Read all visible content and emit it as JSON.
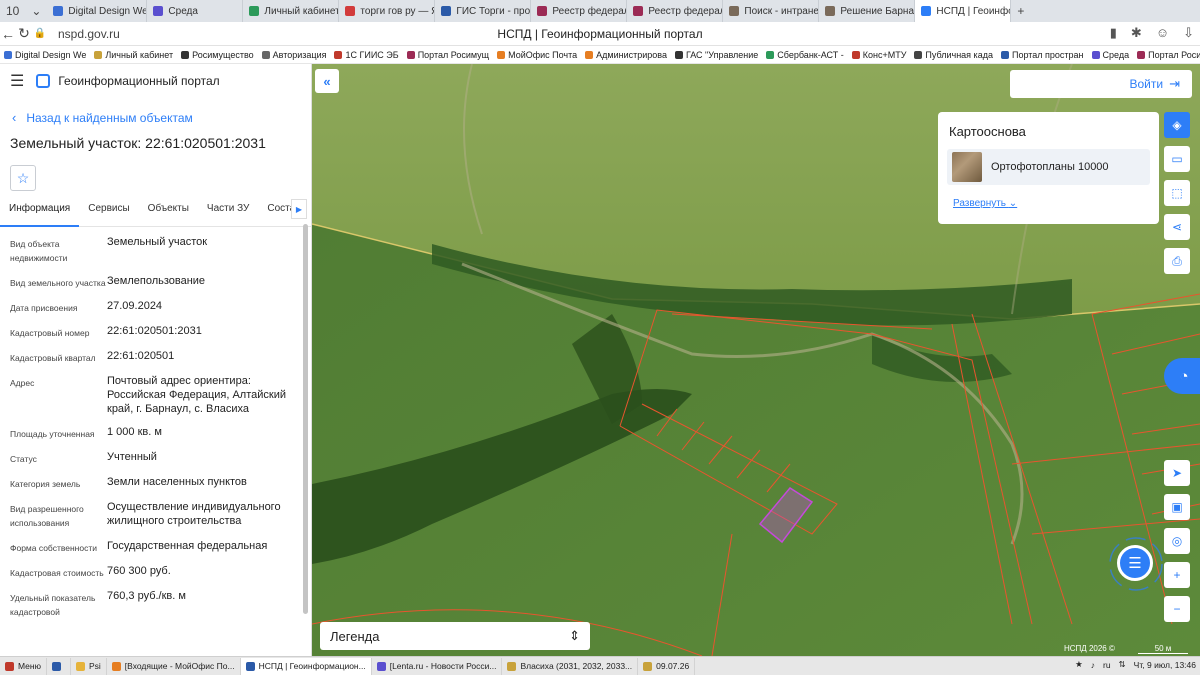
{
  "browser": {
    "tab_count": "10",
    "tabs": [
      {
        "label": "Digital Design We",
        "color": "#3b6fd4"
      },
      {
        "label": "Среда",
        "color": "#5a4fcf"
      },
      {
        "label": "Личный кабинет",
        "color": "#2c9a5a"
      },
      {
        "label": "торги гов ру — Я",
        "color": "#d23b3b"
      },
      {
        "label": "ГИС Торги - прод",
        "color": "#2b5aa8"
      },
      {
        "label": "Реестр федераль",
        "color": "#9c2b55"
      },
      {
        "label": "Реестр федераль",
        "color": "#9c2b55"
      },
      {
        "label": "Поиск - интранет",
        "color": "#7a6a5a"
      },
      {
        "label": "Решение Барнаул",
        "color": "#7a6a5a"
      },
      {
        "label": "НСПД | Геоинфо",
        "color": "#2d7ef7"
      }
    ],
    "new_tab": "+",
    "url": "nspd.gov.ru",
    "page_title": "НСПД | Геоинформационный портал"
  },
  "bookmarks": [
    {
      "label": "Digital Design We",
      "color": "#3b6fd4"
    },
    {
      "label": "Личный кабинет",
      "color": "#c8a23a"
    },
    {
      "label": "Росимущество",
      "color": "#333333"
    },
    {
      "label": "Авторизация",
      "color": "#666666"
    },
    {
      "label": "1С ГИИС ЭБ",
      "color": "#c0392b"
    },
    {
      "label": "Портал Росимущ",
      "color": "#9c2b55"
    },
    {
      "label": "МойОфис Почта",
      "color": "#e67e22"
    },
    {
      "label": "Администрирова",
      "color": "#e67e22"
    },
    {
      "label": "ГАС \"Управление",
      "color": "#333333"
    },
    {
      "label": "Сбербанк-АСТ -",
      "color": "#2c9a5a"
    },
    {
      "label": "Конс+МТУ",
      "color": "#c0392b"
    },
    {
      "label": "Публичная када",
      "color": "#444444"
    },
    {
      "label": "Портал простран",
      "color": "#2b5aa8"
    },
    {
      "label": "Среда",
      "color": "#5a4fcf"
    },
    {
      "label": "Портал Роси",
      "color": "#9c2b55"
    }
  ],
  "app": {
    "title": "Геоинформационный портал",
    "back_label": "Назад к найденным объектам",
    "object_title": "Земельный участок: 22:61:020501:2031",
    "tabs": [
      "Информация",
      "Сервисы",
      "Объекты",
      "Части ЗУ",
      "Состав"
    ],
    "properties": [
      {
        "key": "Вид объекта недвижимости",
        "value": "Земельный участок"
      },
      {
        "key": "Вид земельного участка",
        "value": "Землепользование"
      },
      {
        "key": "Дата присвоения",
        "value": "27.09.2024"
      },
      {
        "key": "Кадастровый номер",
        "value": "22:61:020501:2031"
      },
      {
        "key": "Кадастровый квартал",
        "value": "22:61:020501"
      },
      {
        "key": "Адрес",
        "value": "Почтовый адрес ориентира: Российская Федерация, Алтайский край, г. Барнаул, с. Власиха"
      },
      {
        "key": "Площадь уточненная",
        "value": "1 000 кв. м"
      },
      {
        "key": "Статус",
        "value": "Учтенный"
      },
      {
        "key": "Категория земель",
        "value": "Земли населенных пунктов"
      },
      {
        "key": "Вид разрешенного использования",
        "value": "Осуществление индивидуального жилищного строительства"
      },
      {
        "key": "Форма собственности",
        "value": "Государственная федеральная"
      },
      {
        "key": "Кадастровая стоимость",
        "value": "760 300 руб."
      },
      {
        "key": "Удельный показатель кадастровой",
        "value": "760,3 руб./кв. м"
      }
    ]
  },
  "map": {
    "login_label": "Войти",
    "basemap_title": "Картооснова",
    "basemap_layer": "Ортофотопланы 10000",
    "expand_label": "Развернуть",
    "legend_label": "Легенда",
    "copyright": "НСПД 2026 ©",
    "scale_label": "50 м"
  },
  "taskbar": {
    "items": [
      {
        "label": "Меню",
        "color": "#c0392b"
      },
      {
        "label": "",
        "color": "#2b5aa8"
      },
      {
        "label": "Psi",
        "color": "#e6b33a"
      },
      {
        "label": "[Входящие - МойОфис По...",
        "color": "#e67e22"
      },
      {
        "label": "НСПД | Геоинформацион...",
        "color": "#2b5aa8"
      },
      {
        "label": "[Lenta.ru - Новости Росси...",
        "color": "#5a4fcf"
      },
      {
        "label": "Власиха (2031, 2032, 2033...",
        "color": "#c8a23a"
      },
      {
        "label": "09.07.26",
        "color": "#c8a23a"
      }
    ],
    "lang": "ru",
    "clock": "Чт, 9 июл, 13:46"
  }
}
